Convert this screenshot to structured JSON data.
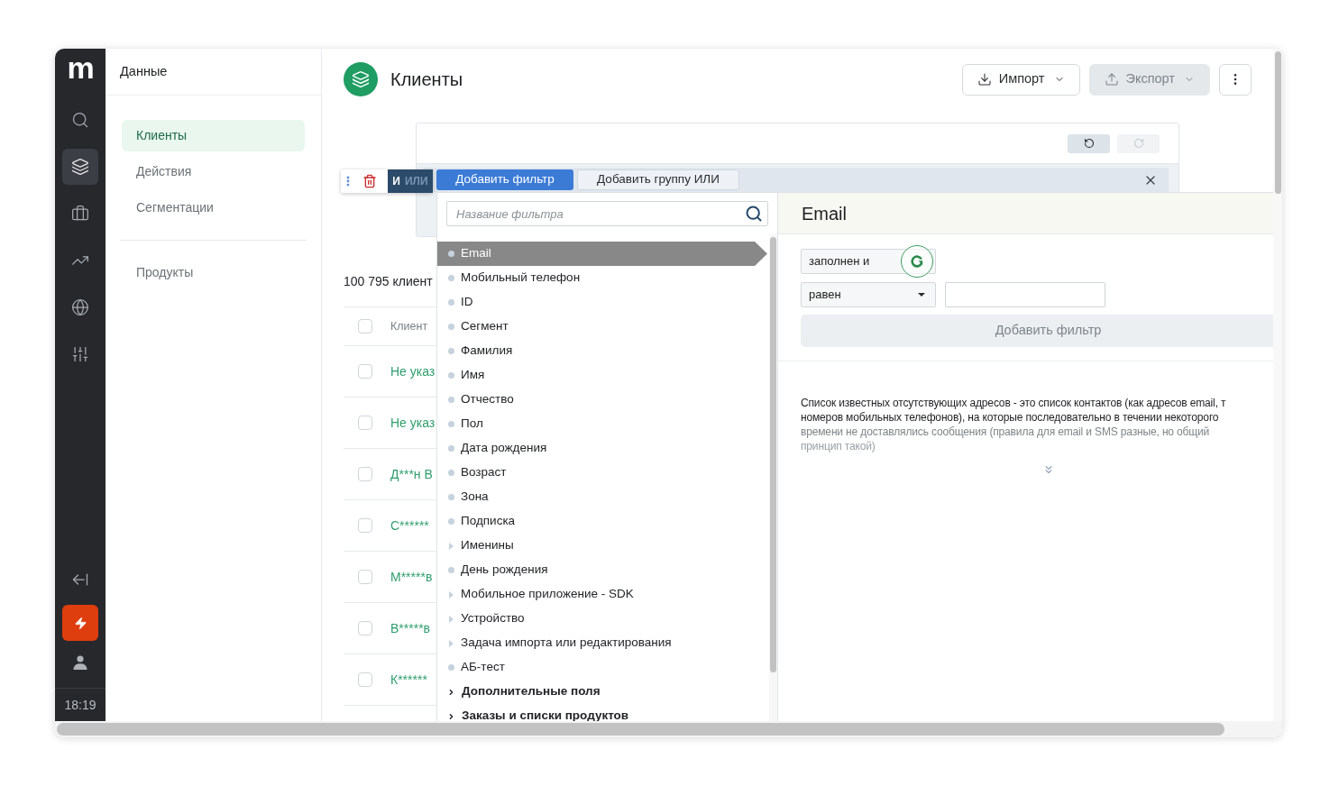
{
  "logo": "m",
  "rail": {
    "items": [
      {
        "selected": false
      },
      {
        "selected": true
      },
      {
        "selected": false
      },
      {
        "selected": false
      },
      {
        "selected": false
      },
      {
        "selected": false
      }
    ],
    "time": "18:19"
  },
  "sidebar": {
    "title": "Данные",
    "sections": [
      {
        "items": [
          {
            "label": "Клиенты",
            "selected": true
          },
          {
            "label": "Действия",
            "selected": false
          },
          {
            "label": "Сегментации",
            "selected": false
          }
        ]
      },
      {
        "items": [
          {
            "label": "Продукты",
            "selected": false
          }
        ]
      }
    ]
  },
  "header": {
    "title": "Клиенты",
    "buttons": [
      {
        "label": "Импорт",
        "disabled": false
      },
      {
        "label": "Экспорт",
        "disabled": true
      }
    ]
  },
  "filter_panel": {
    "history": [
      {
        "disabled": false
      },
      {
        "disabled": true
      }
    ],
    "logic": [
      {
        "label": "И",
        "selected": true
      },
      {
        "label": "ИЛИ",
        "selected": false
      }
    ],
    "actions": [
      {
        "label": "Добавить фильтр",
        "selected": true
      },
      {
        "label": "Добавить группу ИЛИ",
        "selected": false
      }
    ]
  },
  "table": {
    "count": "100 795 клиент",
    "columns": [
      "Клиент"
    ],
    "header_checked": false,
    "rows": [
      {
        "name": "Не указ",
        "checked": false
      },
      {
        "name": "Не указ",
        "checked": false
      },
      {
        "name": "Д***н В",
        "checked": false
      },
      {
        "name": "С******",
        "checked": false
      },
      {
        "name": "М*****в",
        "checked": false
      },
      {
        "name": "В*****в",
        "checked": false
      },
      {
        "name": "К******",
        "checked": false
      }
    ]
  },
  "filter_popup": {
    "search": {
      "placeholder": "Название фильтра"
    },
    "items": [
      {
        "label": "Email",
        "kind": "field",
        "selected": true
      },
      {
        "label": "Мобильный телефон",
        "kind": "field",
        "selected": false
      },
      {
        "label": "ID",
        "kind": "field",
        "selected": false
      },
      {
        "label": "Сегмент",
        "kind": "field",
        "selected": false
      },
      {
        "label": "Фамилия",
        "kind": "field",
        "selected": false
      },
      {
        "label": "Имя",
        "kind": "field",
        "selected": false
      },
      {
        "label": "Отчество",
        "kind": "field",
        "selected": false
      },
      {
        "label": "Пол",
        "kind": "field",
        "selected": false
      },
      {
        "label": "Дата рождения",
        "kind": "field",
        "selected": false
      },
      {
        "label": "Возраст",
        "kind": "field",
        "selected": false
      },
      {
        "label": "Зона",
        "kind": "field",
        "selected": false
      },
      {
        "label": "Подписка",
        "kind": "field",
        "selected": false
      },
      {
        "label": "Именины",
        "kind": "group",
        "selected": false
      },
      {
        "label": "День рождения",
        "kind": "field",
        "selected": false
      },
      {
        "label": "Мобильное приложение - SDK",
        "kind": "group",
        "selected": false
      },
      {
        "label": "Устройство",
        "kind": "group",
        "selected": false
      },
      {
        "label": "Задача импорта или редактирования",
        "kind": "group",
        "selected": false
      },
      {
        "label": "АБ-тест",
        "kind": "field",
        "selected": false
      },
      {
        "label": "Дополнительные поля",
        "kind": "section",
        "selected": false
      },
      {
        "label": "Заказы и списки продуктов",
        "kind": "section",
        "selected": false
      }
    ],
    "detail": {
      "title": "Email",
      "condition": "заполнен и",
      "operator": "равен",
      "button": "Добавить фильтр",
      "description": [
        "Список известных отсутствующих адресов - это список контактов (как адресов email, т",
        "номеров мобильных телефонов), на которые последовательно в течении некоторого",
        "времени не доставлялись сообщения (правила для email и SMS разные, но общий",
        "принцип такой)"
      ]
    }
  }
}
